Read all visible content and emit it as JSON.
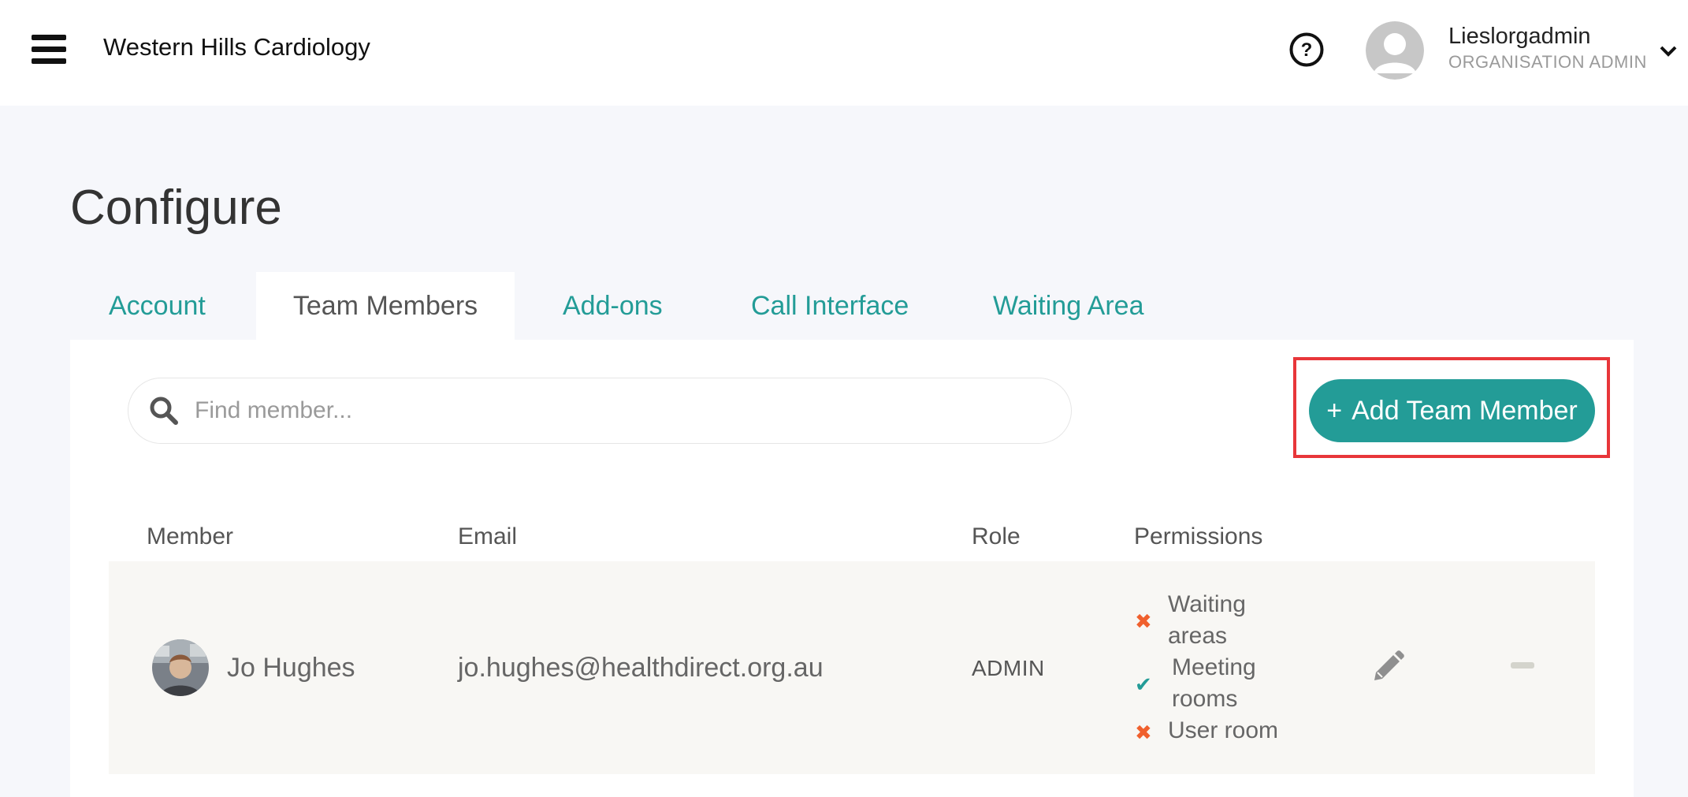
{
  "header": {
    "org_name": "Western Hills Cardiology",
    "user_name": "Lieslorgadmin",
    "user_role": "ORGANISATION ADMIN"
  },
  "page": {
    "title": "Configure"
  },
  "tabs": [
    {
      "label": "Account",
      "active": false
    },
    {
      "label": "Team Members",
      "active": true
    },
    {
      "label": "Add-ons",
      "active": false
    },
    {
      "label": "Call Interface",
      "active": false
    },
    {
      "label": "Waiting Area",
      "active": false
    }
  ],
  "search": {
    "placeholder": "Find member...",
    "value": ""
  },
  "add_button": {
    "icon": "+",
    "label": "Add Team Member"
  },
  "table": {
    "headers": [
      "Member",
      "Email",
      "Role",
      "Permissions"
    ],
    "rows": [
      {
        "name": "Jo Hughes",
        "email": "jo.hughes@healthdirect.org.au",
        "role": "ADMIN",
        "permissions": [
          {
            "label": "Waiting areas",
            "line1": "Waiting",
            "line2": "areas",
            "granted": false,
            "mark": "✖"
          },
          {
            "label": "Meeting rooms",
            "line1": "Meeting",
            "line2": "rooms",
            "granted": true,
            "mark": "✔"
          },
          {
            "label": "User room",
            "line1": "User room",
            "line2": "",
            "granted": false,
            "mark": "✖"
          }
        ]
      }
    ]
  },
  "colors": {
    "accent": "#239c97",
    "denied": "#f0602d",
    "highlight": "#e8363a",
    "row_bg": "#f8f7f4",
    "page_bg": "#f6f7fb"
  },
  "icons": [
    "menu-icon",
    "help-icon",
    "user-avatar-icon",
    "chevron-down-icon",
    "search-icon",
    "plus-icon",
    "edit-icon",
    "remove-icon"
  ]
}
